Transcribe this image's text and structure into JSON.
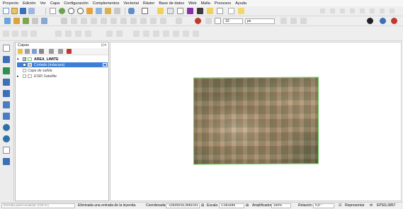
{
  "menu": [
    "Proyecto",
    "Edición",
    "Ver",
    "Capa",
    "Configuración",
    "Complementos",
    "Vectorial",
    "Ráster",
    "Base de datos",
    "Web",
    "Malla",
    "Procesos",
    "Ayuda"
  ],
  "toolbar": {
    "size_value": "10",
    "size_unit": "px"
  },
  "layers_panel": {
    "title": "Capas",
    "items": [
      {
        "label": "AREA_LIMITE",
        "checked": true,
        "bold": true,
        "selected": false,
        "indent": 1
      },
      {
        "label": "Cortado (máscara)",
        "checked": true,
        "bold": false,
        "selected": true,
        "indent": 1
      },
      {
        "label": "Capa de salida",
        "checked": false,
        "bold": false,
        "selected": false,
        "indent": 2,
        "italic": true
      },
      {
        "label": "ESRI Satellite",
        "checked": false,
        "bold": false,
        "selected": false,
        "indent": 1,
        "italic": true
      }
    ]
  },
  "status": {
    "search_placeholder": "Escriba para localizar (Ctrl+K)",
    "message": "Eliminada una entrada de la leyenda.",
    "coord_label": "Coordenada",
    "coord_value": "-12829215,3851011",
    "scale_label": "Escala",
    "scale_value": "1:254495",
    "magnifier_label": "Amplificador",
    "magnifier_value": "100%",
    "rotation_label": "Rotación",
    "rotation_value": "0,0 °",
    "render_label": "Representar",
    "crs": "EPSG:3857"
  },
  "colors": {
    "selection": "#3d7fd6",
    "raster_border": "#6ccf5b"
  }
}
